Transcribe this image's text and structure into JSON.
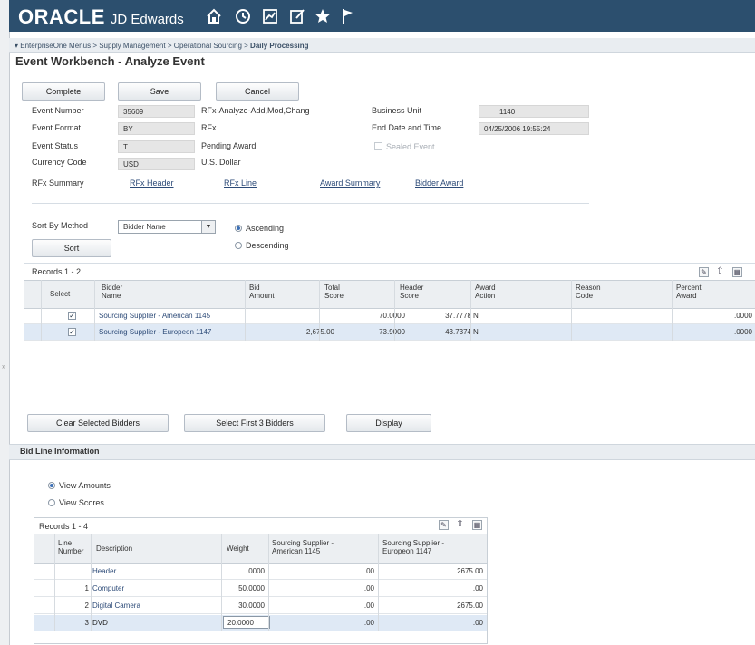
{
  "app": {
    "brand": "ORACLE",
    "product": "JD Edwards",
    "icons": [
      "home-icon",
      "history-icon",
      "chart-icon",
      "edit-icon",
      "star-icon",
      "flag-icon"
    ]
  },
  "breadcrumb": {
    "items": [
      "EnterpriseOne Menus",
      "Supply Management",
      "Operational Sourcing",
      "Daily Processing"
    ],
    "separator": ">"
  },
  "page": {
    "title": "Event Workbench - Analyze Event"
  },
  "toolbar": {
    "complete": "Complete",
    "save": "Save",
    "cancel": "Cancel"
  },
  "header": {
    "event_number_label": "Event Number",
    "event_number": "35609",
    "event_number_desc": "RFx-Analyze-Add,Mod,Chang",
    "event_format_label": "Event Format",
    "event_format": "BY",
    "event_format_desc": "RFx",
    "event_status_label": "Event Status",
    "event_status": "T",
    "event_status_desc": "Pending Award",
    "currency_code_label": "Currency Code",
    "currency_code": "USD",
    "currency_code_desc": "U.S. Dollar",
    "business_unit_label": "Business Unit",
    "business_unit": "1140",
    "end_date_label": "End Date and Time",
    "end_date": "04/25/2006 19:55:24",
    "sealed_event_label": "Sealed Event",
    "sealed_event_checked": false,
    "rfx_summary_label": "RFx Summary",
    "links": [
      "RFx Header",
      "RFx Line",
      "Award Summary",
      "Bidder Award"
    ]
  },
  "sort": {
    "method_label": "Sort By Method",
    "method_value": "Bidder Name",
    "ascending": "Ascending",
    "descending": "Descending",
    "selected": "Ascending",
    "button": "Sort"
  },
  "bidders_grid": {
    "records": "Records 1 - 2",
    "columns": [
      "Select",
      "Bidder Name",
      "Bid Amount",
      "Total Score",
      "Header Score",
      "Award Action",
      "Reason Code",
      "Percent Award"
    ],
    "column_lines": [
      [
        "Select"
      ],
      [
        "Bidder",
        "Name"
      ],
      [
        "Bid",
        "Amount"
      ],
      [
        "Total",
        "Score"
      ],
      [
        "Header",
        "Score"
      ],
      [
        "Award",
        "Action"
      ],
      [
        "Reason",
        "Code"
      ],
      [
        "Percent",
        "Award"
      ]
    ],
    "rows": [
      {
        "selected": true,
        "bidder": "Sourcing Supplier - American 1145",
        "bid_amount": "",
        "total_score": "70.0000",
        "header_score": "37.7778",
        "award_action": "N",
        "reason_code": "",
        "percent_award": ".0000"
      },
      {
        "selected": true,
        "bidder": "Sourcing Supplier - Europeon 1147",
        "bid_amount": "2,675.00",
        "total_score": "73.9000",
        "header_score": "43.7374",
        "award_action": "N",
        "reason_code": "",
        "percent_award": ".0000"
      }
    ]
  },
  "actions": {
    "clear": "Clear Selected Bidders",
    "select_first": "Select First 3 Bidders",
    "display": "Display"
  },
  "bid_line": {
    "section_title": "Bid Line Information",
    "view_amounts": "View Amounts",
    "view_scores": "View Scores",
    "selected_view": "View Amounts",
    "records": "Records 1 - 4",
    "column_lines": [
      [
        "Line",
        "Number"
      ],
      [
        "Description"
      ],
      [
        "Weight"
      ],
      [
        "Sourcing Supplier -",
        "American 1145"
      ],
      [
        "Sourcing Supplier -",
        "Europeon 1147"
      ]
    ],
    "rows": [
      {
        "line": "",
        "description": "Header",
        "weight": ".0000",
        "american": ".00",
        "europeon": "2675.00"
      },
      {
        "line": "1",
        "description": "Computer",
        "weight": "50.0000",
        "american": ".00",
        "europeon": ".00"
      },
      {
        "line": "2",
        "description": "Digital Camera",
        "weight": "30.0000",
        "american": ".00",
        "europeon": "2675.00"
      },
      {
        "line": "3",
        "description": "DVD",
        "weight": "20.0000",
        "american": ".00",
        "europeon": ".00"
      }
    ]
  },
  "colors": {
    "banner": "#2c4f6e",
    "link": "#2d4b78",
    "selected_row": "#dfe9f5"
  }
}
